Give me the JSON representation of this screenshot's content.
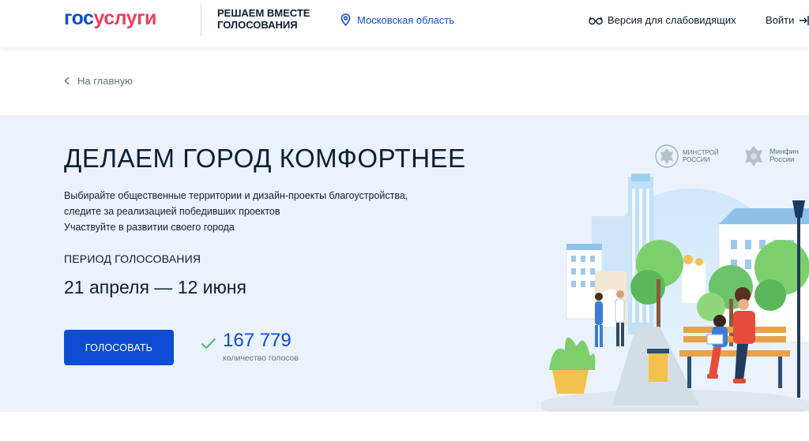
{
  "header": {
    "logo_part1": "гос",
    "logo_part2": "услуги",
    "slogan_line1": "РЕШАЕМ ВМЕСТЕ",
    "slogan_line2": "ГОЛОСОВАНИЯ",
    "region": "Московская область",
    "low_vision": "Версия для слабовидящих",
    "login": "Войти"
  },
  "nav": {
    "back_label": "На главную"
  },
  "hero": {
    "title": "ДЕЛАЕМ ГОРОД КОМФОРТНЕЕ",
    "desc_line1": "Выбирайте общественные территории и дизайн-проекты благоустройства,",
    "desc_line2": "следите за реализацией победивших проектов",
    "desc_line3": "Участвуйте в развитии своего города",
    "period_label": "ПЕРИОД ГОЛОСОВАНИЯ",
    "period": "21 апреля — 12 июня",
    "vote_button": "ГОЛОСОВАТЬ",
    "votes_count": "167 779",
    "votes_label": "количество голосов"
  },
  "partners": {
    "minstroy_line1": "МИНСТРОЙ",
    "minstroy_line2": "РОССИИ",
    "minfin_line1": "Минфин",
    "minfin_line2": "России"
  },
  "colors": {
    "brand_blue": "#0d4cd3",
    "brand_red": "#ee3f58",
    "hero_bg": "#ebf2fc",
    "check_green": "#5bbf66"
  },
  "icons": {
    "region": "location-pin-icon",
    "low_vision": "glasses-icon",
    "login": "login-arrow-icon",
    "back": "chevron-left-icon",
    "votes": "checkmark-icon"
  }
}
